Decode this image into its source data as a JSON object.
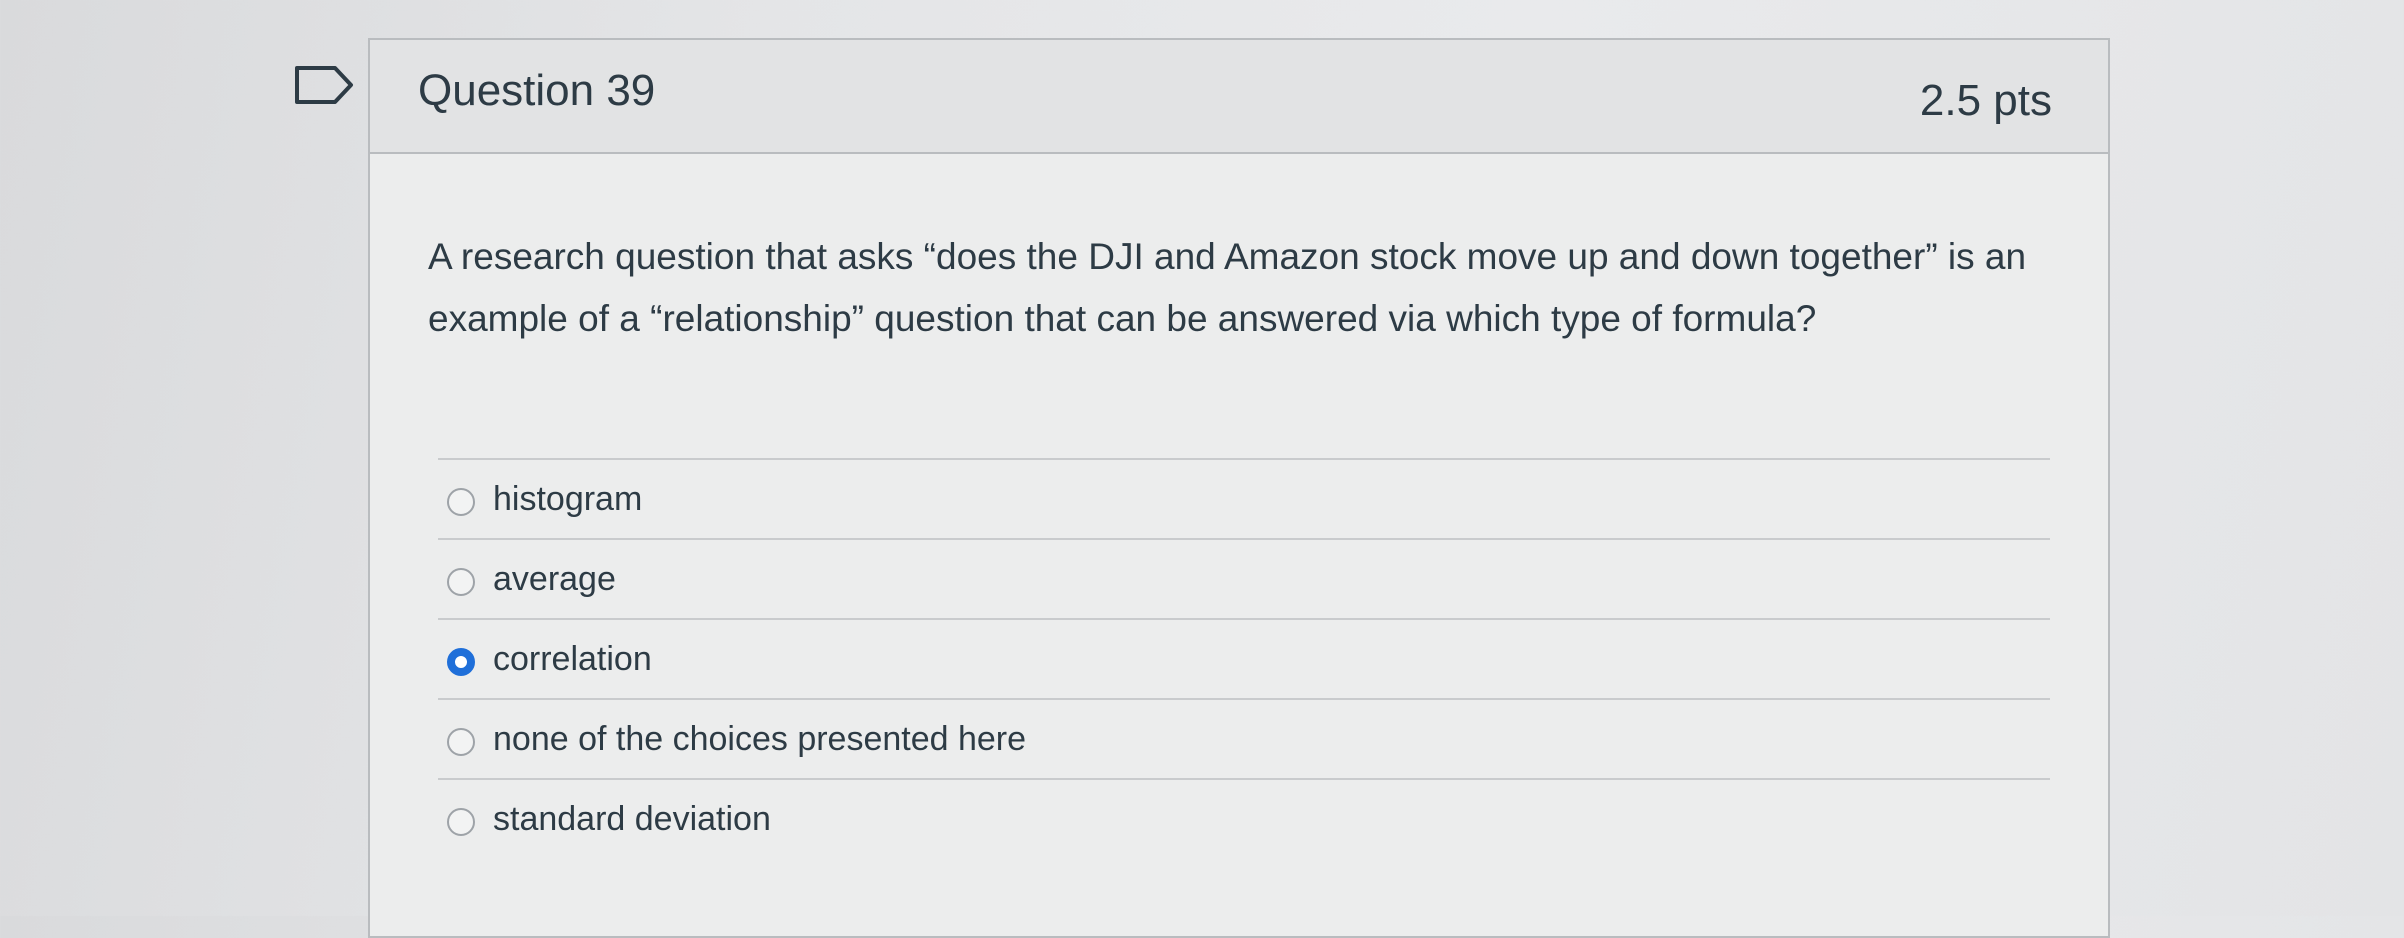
{
  "question": {
    "title": "Question 39",
    "points": "2.5 pts",
    "text": "A research question that asks “does the DJI and Amazon stock move up and down together” is an example of a “relationship” question that can be answered via which type of formula?",
    "flag_icon": "flag-icon"
  },
  "answers": [
    {
      "label": "histogram",
      "selected": false
    },
    {
      "label": "average",
      "selected": false
    },
    {
      "label": "correlation",
      "selected": true
    },
    {
      "label": "none of the choices presented here",
      "selected": false
    },
    {
      "label": "standard deviation",
      "selected": false
    }
  ],
  "colors": {
    "accent": "#1f6fd9",
    "text": "#2d3b45",
    "border": "#b9bcbf"
  }
}
